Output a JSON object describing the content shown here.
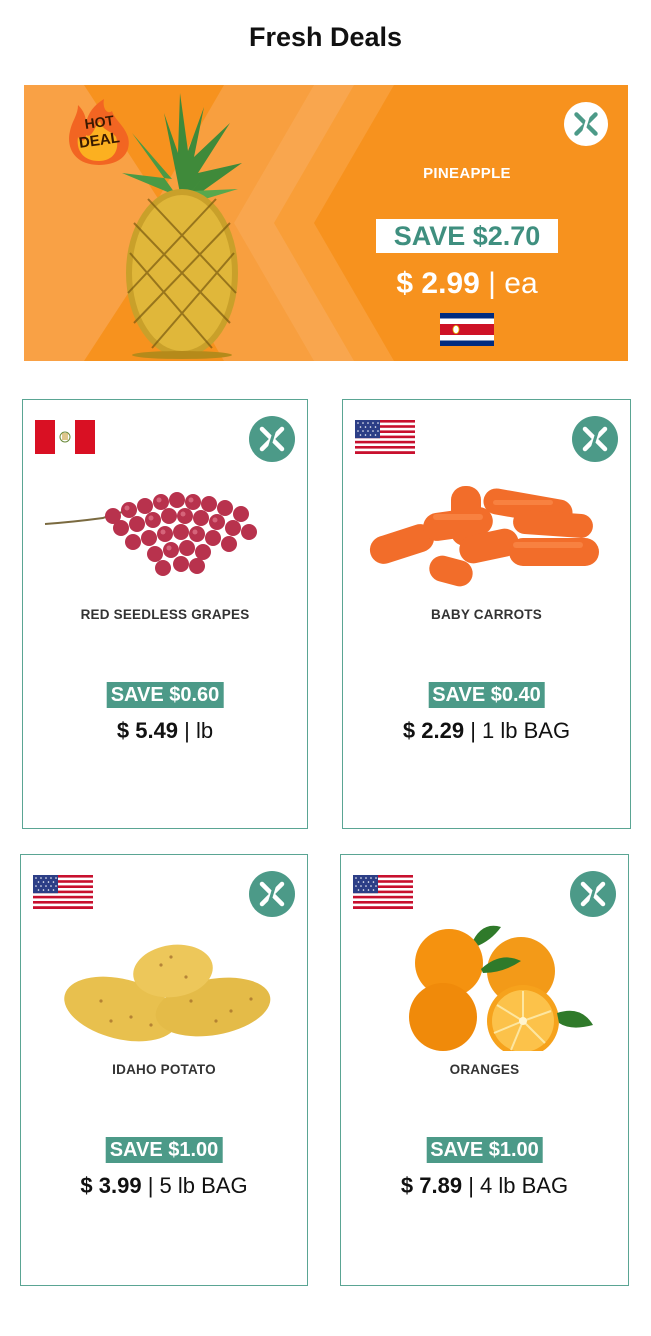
{
  "title": "Fresh Deals",
  "hero": {
    "badge": "HOT DEAL",
    "name": "PINEAPPLE",
    "save": "SAVE $2.70",
    "price": "$ 2.99",
    "unit": "| ea",
    "flag": "costa-rica-flag-icon",
    "colors": {
      "background": "#f7921e",
      "save_text": "#3f8f7f"
    }
  },
  "products": [
    {
      "name": "RED SEEDLESS GRAPES",
      "save": "SAVE $0.60",
      "price": "$ 5.49",
      "unit": "| lb",
      "flag": "peru-flag-icon"
    },
    {
      "name": "BABY CARROTS",
      "save": "SAVE $0.40",
      "price": "$ 2.29",
      "unit": "| 1 lb BAG",
      "flag": "usa-flag-icon"
    },
    {
      "name": "IDAHO POTATO",
      "save": "SAVE $1.00",
      "price": "$ 3.99",
      "unit": "| 5 lb BAG",
      "flag": "usa-flag-icon"
    },
    {
      "name": "ORANGES",
      "save": "SAVE $1.00",
      "price": "$ 7.89",
      "unit": "| 4 lb BAG",
      "flag": "usa-flag-icon"
    }
  ],
  "colors": {
    "accent": "#4c9a88",
    "border": "#5aa593"
  }
}
